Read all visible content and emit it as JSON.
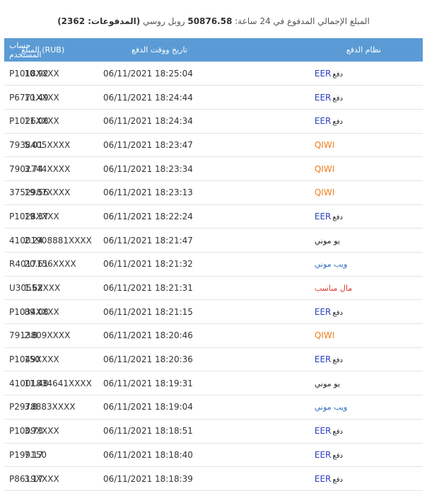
{
  "summary": {
    "prefix": "المبلغ الإجمالي المدفوع في 24 ساعة:",
    "amount": "50876.58",
    "currency": "روبل روسي",
    "payments": "(المدفوعات: 2362)"
  },
  "table": {
    "headers": {
      "account": "حساب المستخدم",
      "amount": "المبلغ (RUB)",
      "datetime": "تاريخ ووقت الدفع",
      "system": "نظام الدفع"
    },
    "rows": [
      {
        "account": "P1018XXXX",
        "amount": "10.92",
        "datetime": "06/11/2021 18:25:04",
        "system": {
          "kind": "eer",
          "lat": "EER",
          "ar": "دفع"
        }
      },
      {
        "account": "P6771XXXX",
        "amount": "10.49",
        "datetime": "06/11/2021 18:24:44",
        "system": {
          "kind": "eer",
          "lat": "EER",
          "ar": "دفع"
        }
      },
      {
        "account": "P1026XXXX",
        "amount": "11.08",
        "datetime": "06/11/2021 18:24:34",
        "system": {
          "kind": "eer",
          "lat": "EER",
          "ar": "دفع"
        }
      },
      {
        "account": "7938405XXXX",
        "amount": "5.01",
        "datetime": "06/11/2021 18:23:47",
        "system": {
          "kind": "qiwi",
          "lat": "QIWI",
          "ar": ""
        }
      },
      {
        "account": "7902744XXXX",
        "amount": "3.74",
        "datetime": "06/11/2021 18:23:34",
        "system": {
          "kind": "qiwi",
          "lat": "QIWI",
          "ar": ""
        }
      },
      {
        "account": "3752987XXXX",
        "amount": "19.56",
        "datetime": "06/11/2021 18:23:13",
        "system": {
          "kind": "qiwi",
          "lat": "QIWI",
          "ar": ""
        }
      },
      {
        "account": "P1028XXXX",
        "amount": "19.37",
        "datetime": "06/11/2021 18:22:24",
        "system": {
          "kind": "eer",
          "lat": "EER",
          "ar": "دفع"
        }
      },
      {
        "account": "41001908881XXXX",
        "amount": "2.24",
        "datetime": "06/11/2021 18:21:47",
        "system": {
          "kind": "yoomoney",
          "lat": "",
          "ar": "يو موني"
        }
      },
      {
        "account": "R4017156XXXX",
        "amount": "20.61",
        "datetime": "06/11/2021 18:21:32",
        "system": {
          "kind": "webmoney",
          "lat": "",
          "ar": "ويب موني"
        }
      },
      {
        "account": "U3055XXXX",
        "amount": "1.62",
        "datetime": "06/11/2021 18:21:31",
        "system": {
          "kind": "mall",
          "lat": "",
          "ar": "مال مناسب"
        }
      },
      {
        "account": "P1034XXXX",
        "amount": "89.08",
        "datetime": "06/11/2021 18:21:15",
        "system": {
          "kind": "eer",
          "lat": "EER",
          "ar": "دفع"
        }
      },
      {
        "account": "7913809XXXX",
        "amount": "2.8",
        "datetime": "06/11/2021 18:20:46",
        "system": {
          "kind": "qiwi",
          "lat": "QIWI",
          "ar": ""
        }
      },
      {
        "account": "P1049XXXX",
        "amount": "150",
        "datetime": "06/11/2021 18:20:36",
        "system": {
          "kind": "eer",
          "lat": "EER",
          "ar": "دفع"
        }
      },
      {
        "account": "41001834641XXXX",
        "amount": "11.48",
        "datetime": "06/11/2021 18:19:31",
        "system": {
          "kind": "yoomoney",
          "lat": "",
          "ar": "يو موني"
        }
      },
      {
        "account": "P2978883XXXX",
        "amount": "3.8",
        "datetime": "06/11/2021 18:19:04",
        "system": {
          "kind": "webmoney",
          "lat": "",
          "ar": "ويب موني"
        }
      },
      {
        "account": "P1009XXXX",
        "amount": "3.73",
        "datetime": "06/11/2021 18:18:51",
        "system": {
          "kind": "eer",
          "lat": "EER",
          "ar": "دفع"
        }
      },
      {
        "account": "P199150",
        "amount": "7.17",
        "datetime": "06/11/2021 18:18:40",
        "system": {
          "kind": "eer",
          "lat": "EER",
          "ar": "دفع"
        }
      },
      {
        "account": "P8619XXXX",
        "amount": "3.17",
        "datetime": "06/11/2021 18:18:39",
        "system": {
          "kind": "eer",
          "lat": "EER",
          "ar": "دفع"
        }
      }
    ]
  }
}
